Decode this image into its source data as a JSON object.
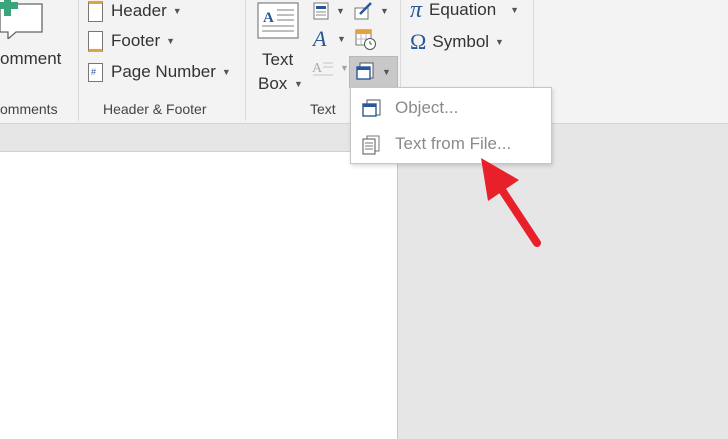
{
  "ribbon": {
    "comments": {
      "button_label": "omment",
      "group_label": "omments"
    },
    "header_footer": {
      "header_label": "Header",
      "footer_label": "Footer",
      "page_number_label": "Page Number",
      "group_label": "Header & Footer"
    },
    "text": {
      "textbox_line1": "Text",
      "textbox_line2": "Box",
      "group_label": "Text"
    },
    "symbols": {
      "equation_label": "Equation",
      "symbol_label": "Symbol"
    }
  },
  "dropdown": {
    "items": [
      {
        "label": "Object..."
      },
      {
        "label": "Text from File..."
      }
    ]
  },
  "colors": {
    "accent_blue": "#2b579a",
    "arrow_red": "#e8202a",
    "comment_green": "#3aa57a"
  }
}
